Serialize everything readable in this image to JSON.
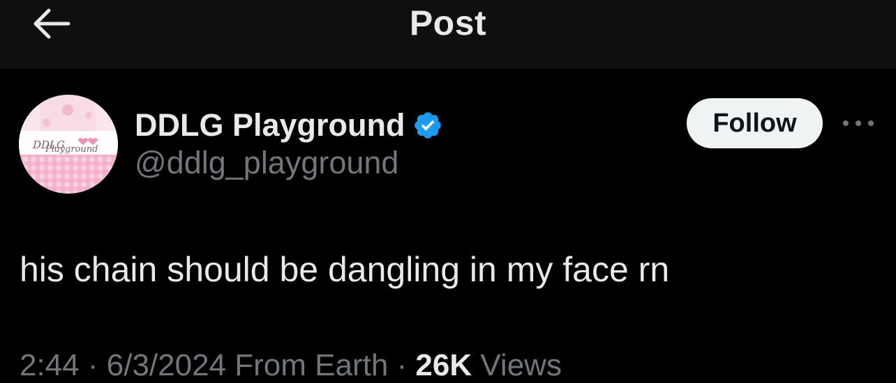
{
  "header": {
    "title": "Post",
    "back_icon": "arrow-left-icon"
  },
  "author": {
    "display_name": "DDLG Playground",
    "handle": "@ddlg_playground",
    "verified": true,
    "verified_color": "#1d9bf0",
    "avatar_text": "DDLG Playground"
  },
  "actions": {
    "follow_label": "Follow",
    "more_icon": "more-horizontal-icon"
  },
  "post": {
    "text": "his chain should be dangling in my face rn"
  },
  "meta": {
    "time": "2:44",
    "date": "6/3/2024",
    "source": "From Earth",
    "views_count": "26K",
    "views_label": "Views"
  }
}
